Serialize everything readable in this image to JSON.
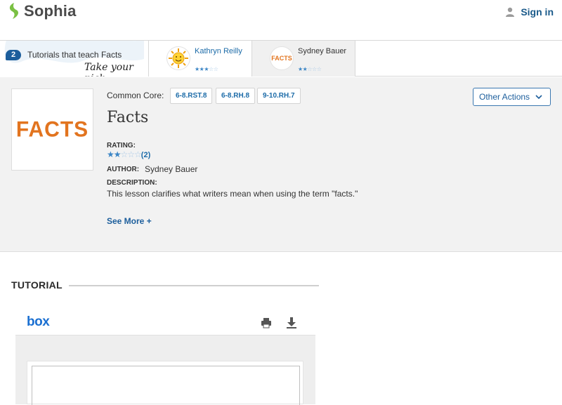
{
  "header": {
    "brand": "Sophia",
    "signin_label": "Sign in"
  },
  "picker": {
    "count": "2",
    "intro": "Tutorials that teach Facts",
    "take_pick": "Take your pick:",
    "tutorials": [
      {
        "author": "Kathryn Reilly",
        "rating": 3,
        "max_rating": 5
      },
      {
        "author": "Sydney Bauer",
        "rating": 2,
        "max_rating": 5,
        "thumb_text": "FACTS"
      }
    ]
  },
  "detail": {
    "thumb_text": "FACTS",
    "common_core_label": "Common Core:",
    "standards": [
      "6-8.RST.8",
      "6-8.RH.8",
      "9-10.RH.7"
    ],
    "other_actions_label": "Other Actions",
    "title": "Facts",
    "rating_label": "RATING:",
    "rating": 2,
    "max_rating": 5,
    "rating_count": "(2)",
    "author_label": "AUTHOR:",
    "author": "Sydney Bauer",
    "description_label": "DESCRIPTION:",
    "description": "This lesson clarifies what writers mean when using the term \"facts.\"",
    "see_more_label": "See More +"
  },
  "tutorial": {
    "heading": "TUTORIAL",
    "viewer_brand": "box"
  },
  "icons": {
    "logo": "sophia-leaf-icon",
    "signin": "person-icon",
    "chevron": "chevron-down-icon",
    "print": "print-icon",
    "download": "download-icon"
  },
  "colors": {
    "brand_green": "#7ac043",
    "link_blue": "#1c6ba8",
    "facts_orange": "#e2741f",
    "box_blue": "#1a6fd1"
  }
}
